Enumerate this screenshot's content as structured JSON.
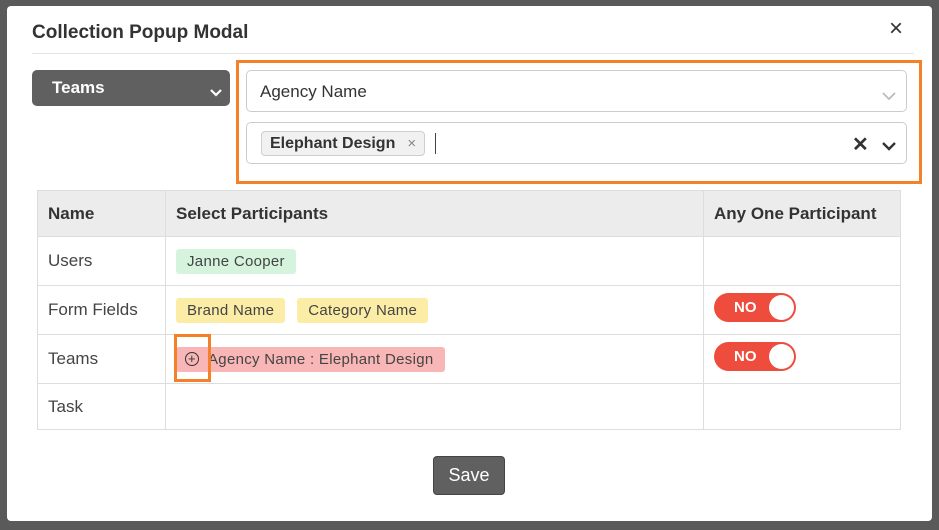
{
  "modal": {
    "title": "Collection Popup Modal",
    "close_icon": "close-icon",
    "save_label": "Save"
  },
  "filters": {
    "type_select_value": "Teams",
    "field_select_value": "Agency Name",
    "selected_chip": "Elephant Design",
    "chip_remove": "×",
    "clear_all": "✕"
  },
  "table": {
    "headers": [
      "Name",
      "Select Participants",
      "Any One Participant"
    ],
    "rows": [
      {
        "name": "Users",
        "participants": [
          "Janne Cooper"
        ]
      },
      {
        "name": "Form Fields",
        "participants": [
          "Brand Name",
          "Category Name"
        ],
        "toggle": "NO"
      },
      {
        "name": "Teams",
        "participants": [
          "Agency Name : Elephant Design"
        ],
        "toggle": "NO",
        "participant_icon": "add-circle-icon"
      },
      {
        "name": "Task",
        "participants": []
      }
    ]
  },
  "colors": {
    "accent_highlight": "#f4812a",
    "toggle_bg": "#ee4c3d",
    "tag_green": "#d6f3dd",
    "tag_yellow": "#fbeda6",
    "tag_red": "#f8b6b6"
  }
}
